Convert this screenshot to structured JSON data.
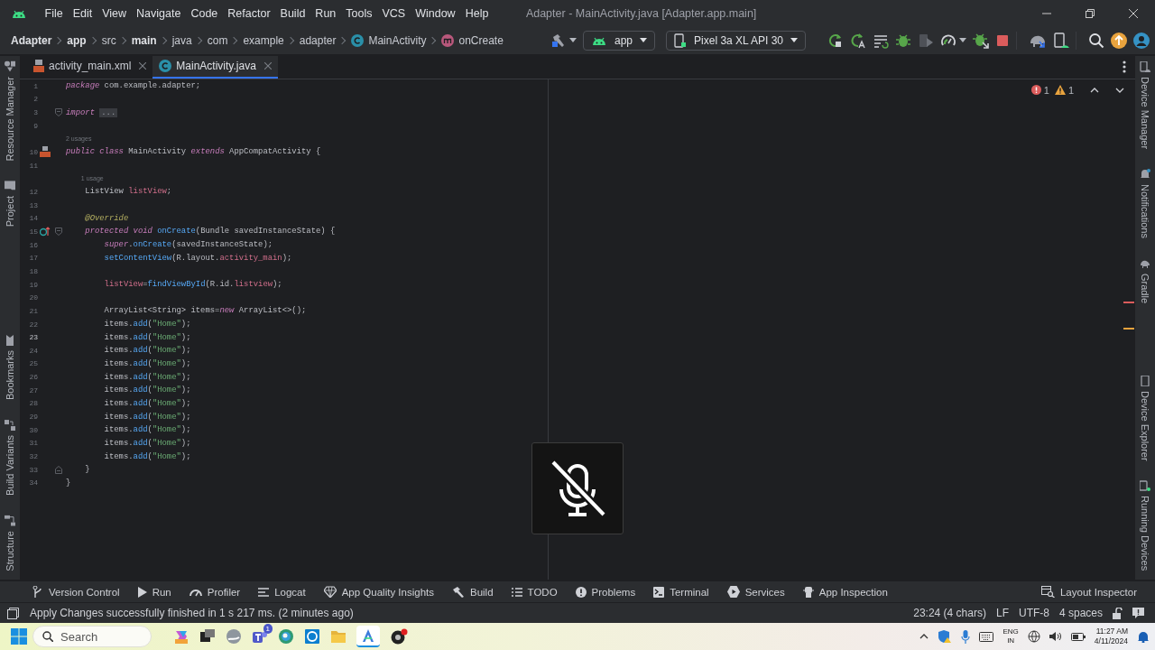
{
  "title_bar": {
    "menu": [
      "File",
      "Edit",
      "View",
      "Navigate",
      "Code",
      "Refactor",
      "Build",
      "Run",
      "Tools",
      "VCS",
      "Window",
      "Help"
    ],
    "title": "Adapter - MainActivity.java [Adapter.app.main]"
  },
  "breadcrumbs": [
    {
      "label": "Adapter",
      "kind": "bold"
    },
    {
      "label": "app",
      "kind": "bold"
    },
    {
      "label": "src",
      "kind": "plain"
    },
    {
      "label": "main",
      "kind": "bold"
    },
    {
      "label": "java",
      "kind": "plain"
    },
    {
      "label": "com",
      "kind": "plain"
    },
    {
      "label": "example",
      "kind": "plain"
    },
    {
      "label": "adapter",
      "kind": "plain"
    },
    {
      "label": "MainActivity",
      "kind": "class"
    },
    {
      "label": "onCreate",
      "kind": "method"
    }
  ],
  "toolbar": {
    "run_config": "app",
    "device": "Pixel 3a XL API 30"
  },
  "tabs": [
    {
      "label": "activity_main.xml",
      "kind": "xml",
      "selected": false
    },
    {
      "label": "MainActivity.java",
      "kind": "class",
      "selected": true
    }
  ],
  "left_panels": {
    "top": [
      "Resource Manager",
      "Project"
    ],
    "bottom": [
      "Bookmarks",
      "Build Variants",
      "Structure"
    ]
  },
  "right_panels": {
    "top": [
      "Device Manager",
      "Notifications",
      "Gradle"
    ],
    "bottom": [
      "Device Explorer",
      "Running Devices"
    ]
  },
  "editor": {
    "errors": "1",
    "warnings": "1",
    "lines": [
      {
        "num": "1",
        "current": false,
        "fold_start": false,
        "fold_end": false,
        "layout_mark": false,
        "override_mark": false,
        "tokens": [
          {
            "kind": "kw",
            "text": "package "
          },
          {
            "kind": "plain",
            "text": "com.example.adapter;"
          }
        ]
      },
      {
        "num": "2",
        "current": false,
        "fold_start": false,
        "fold_end": false,
        "layout_mark": false,
        "override_mark": false
      },
      {
        "num": "3",
        "current": false,
        "fold_start": true,
        "fold_end": false,
        "layout_mark": false,
        "override_mark": false,
        "tokens": [
          {
            "kind": "kw",
            "text": "import "
          },
          {
            "kind": "fold",
            "text": "..."
          }
        ]
      },
      {
        "num": "9",
        "current": false,
        "fold_start": false,
        "fold_end": false,
        "layout_mark": false,
        "override_mark": false
      },
      {
        "num": "10",
        "current": false,
        "hint": "2 usages",
        "fold_start": false,
        "fold_end": false,
        "layout_mark": true,
        "override_mark": false,
        "tokens": [
          {
            "kind": "kw",
            "text": "public class "
          },
          {
            "kind": "plain",
            "text": "MainActivity "
          },
          {
            "kind": "kw",
            "text": "extends "
          },
          {
            "kind": "plain",
            "text": "AppCompatActivity {"
          }
        ]
      },
      {
        "num": "11",
        "current": false,
        "fold_start": false,
        "fold_end": false,
        "layout_mark": false,
        "override_mark": false
      },
      {
        "num": "12",
        "current": false,
        "hint": "1 usage",
        "fold_start": false,
        "fold_end": false,
        "layout_mark": false,
        "override_mark": false,
        "tokens": [
          {
            "kind": "plain",
            "text": "    ListView "
          },
          {
            "kind": "field",
            "text": "listView"
          },
          {
            "kind": "plain",
            "text": ";"
          }
        ]
      },
      {
        "num": "13",
        "current": false,
        "fold_start": false,
        "fold_end": false,
        "layout_mark": false,
        "override_mark": false
      },
      {
        "num": "14",
        "current": false,
        "fold_start": false,
        "fold_end": false,
        "layout_mark": false,
        "override_mark": false,
        "tokens": [
          {
            "kind": "ann",
            "text": "    @Override"
          }
        ]
      },
      {
        "num": "15",
        "current": false,
        "fold_start": true,
        "fold_end": false,
        "layout_mark": false,
        "override_mark": true,
        "tokens": [
          {
            "kind": "kw",
            "text": "    protected void "
          },
          {
            "kind": "method",
            "text": "onCreate"
          },
          {
            "kind": "plain",
            "text": "(Bundle savedInstanceState) {"
          }
        ]
      },
      {
        "num": "16",
        "current": false,
        "fold_start": false,
        "fold_end": false,
        "layout_mark": false,
        "override_mark": false,
        "tokens": [
          {
            "kind": "kw",
            "text": "        super"
          },
          {
            "kind": "plain",
            "text": "."
          },
          {
            "kind": "method",
            "text": "onCreate"
          },
          {
            "kind": "plain",
            "text": "(savedInstanceState);"
          }
        ]
      },
      {
        "num": "17",
        "current": false,
        "fold_start": false,
        "fold_end": false,
        "layout_mark": false,
        "override_mark": false,
        "tokens": [
          {
            "kind": "method",
            "text": "        setContentView"
          },
          {
            "kind": "plain",
            "text": "(R.layout."
          },
          {
            "kind": "field",
            "text": "activity_main"
          },
          {
            "kind": "plain",
            "text": ");"
          }
        ]
      },
      {
        "num": "18",
        "current": false,
        "fold_start": false,
        "fold_end": false,
        "layout_mark": false,
        "override_mark": false
      },
      {
        "num": "19",
        "current": false,
        "fold_start": false,
        "fold_end": false,
        "layout_mark": false,
        "override_mark": false,
        "tokens": [
          {
            "kind": "field",
            "text": "        listView"
          },
          {
            "kind": "plain",
            "text": "="
          },
          {
            "kind": "method",
            "text": "findViewById"
          },
          {
            "kind": "plain",
            "text": "(R.id."
          },
          {
            "kind": "field",
            "text": "listview"
          },
          {
            "kind": "plain",
            "text": ");"
          }
        ]
      },
      {
        "num": "20",
        "current": false,
        "fold_start": false,
        "fold_end": false,
        "layout_mark": false,
        "override_mark": false
      },
      {
        "num": "21",
        "current": false,
        "fold_start": false,
        "fold_end": false,
        "layout_mark": false,
        "override_mark": false,
        "tokens": [
          {
            "kind": "plain",
            "text": "        ArrayList<String> items="
          },
          {
            "kind": "kw",
            "text": "new "
          },
          {
            "kind": "plain",
            "text": "ArrayList<>();"
          }
        ]
      },
      {
        "num": "22",
        "current": false,
        "fold_start": false,
        "fold_end": false,
        "layout_mark": false,
        "override_mark": false,
        "tokens": [
          {
            "kind": "plain",
            "text": "        items."
          },
          {
            "kind": "method",
            "text": "add"
          },
          {
            "kind": "plain",
            "text": "("
          },
          {
            "kind": "str",
            "text": "\"Home\""
          },
          {
            "kind": "plain",
            "text": ");"
          }
        ]
      },
      {
        "num": "23",
        "current": true,
        "fold_start": false,
        "fold_end": false,
        "layout_mark": false,
        "override_mark": false,
        "tokens": [
          {
            "kind": "plain",
            "text": "        items."
          },
          {
            "kind": "method",
            "text": "add"
          },
          {
            "kind": "plain",
            "text": "("
          },
          {
            "kind": "str",
            "text": "\"Home\""
          },
          {
            "kind": "plain",
            "text": ");"
          }
        ]
      },
      {
        "num": "24",
        "current": false,
        "fold_start": false,
        "fold_end": false,
        "layout_mark": false,
        "override_mark": false,
        "tokens": [
          {
            "kind": "plain",
            "text": "        items."
          },
          {
            "kind": "method",
            "text": "add"
          },
          {
            "kind": "plain",
            "text": "("
          },
          {
            "kind": "str",
            "text": "\"Home\""
          },
          {
            "kind": "plain",
            "text": ");"
          }
        ]
      },
      {
        "num": "25",
        "current": false,
        "fold_start": false,
        "fold_end": false,
        "layout_mark": false,
        "override_mark": false,
        "tokens": [
          {
            "kind": "plain",
            "text": "        items."
          },
          {
            "kind": "method",
            "text": "add"
          },
          {
            "kind": "plain",
            "text": "("
          },
          {
            "kind": "str",
            "text": "\"Home\""
          },
          {
            "kind": "plain",
            "text": ");"
          }
        ]
      },
      {
        "num": "26",
        "current": false,
        "fold_start": false,
        "fold_end": false,
        "layout_mark": false,
        "override_mark": false,
        "tokens": [
          {
            "kind": "plain",
            "text": "        items."
          },
          {
            "kind": "method",
            "text": "add"
          },
          {
            "kind": "plain",
            "text": "("
          },
          {
            "kind": "str",
            "text": "\"Home\""
          },
          {
            "kind": "plain",
            "text": ");"
          }
        ]
      },
      {
        "num": "27",
        "current": false,
        "fold_start": false,
        "fold_end": false,
        "layout_mark": false,
        "override_mark": false,
        "tokens": [
          {
            "kind": "plain",
            "text": "        items."
          },
          {
            "kind": "method",
            "text": "add"
          },
          {
            "kind": "plain",
            "text": "("
          },
          {
            "kind": "str",
            "text": "\"Home\""
          },
          {
            "kind": "plain",
            "text": ");"
          }
        ]
      },
      {
        "num": "28",
        "current": false,
        "fold_start": false,
        "fold_end": false,
        "layout_mark": false,
        "override_mark": false,
        "tokens": [
          {
            "kind": "plain",
            "text": "        items."
          },
          {
            "kind": "method",
            "text": "add"
          },
          {
            "kind": "plain",
            "text": "("
          },
          {
            "kind": "str",
            "text": "\"Home\""
          },
          {
            "kind": "plain",
            "text": ");"
          }
        ]
      },
      {
        "num": "29",
        "current": false,
        "fold_start": false,
        "fold_end": false,
        "layout_mark": false,
        "override_mark": false,
        "tokens": [
          {
            "kind": "plain",
            "text": "        items."
          },
          {
            "kind": "method",
            "text": "add"
          },
          {
            "kind": "plain",
            "text": "("
          },
          {
            "kind": "str",
            "text": "\"Home\""
          },
          {
            "kind": "plain",
            "text": ");"
          }
        ]
      },
      {
        "num": "30",
        "current": false,
        "fold_start": false,
        "fold_end": false,
        "layout_mark": false,
        "override_mark": false,
        "tokens": [
          {
            "kind": "plain",
            "text": "        items."
          },
          {
            "kind": "method",
            "text": "add"
          },
          {
            "kind": "plain",
            "text": "("
          },
          {
            "kind": "str",
            "text": "\"Home\""
          },
          {
            "kind": "plain",
            "text": ");"
          }
        ]
      },
      {
        "num": "31",
        "current": false,
        "fold_start": false,
        "fold_end": false,
        "layout_mark": false,
        "override_mark": false,
        "tokens": [
          {
            "kind": "plain",
            "text": "        items."
          },
          {
            "kind": "method",
            "text": "add"
          },
          {
            "kind": "plain",
            "text": "("
          },
          {
            "kind": "str",
            "text": "\"Home\""
          },
          {
            "kind": "plain",
            "text": ");"
          }
        ]
      },
      {
        "num": "32",
        "current": false,
        "fold_start": false,
        "fold_end": false,
        "layout_mark": false,
        "override_mark": false,
        "tokens": [
          {
            "kind": "plain",
            "text": "        items."
          },
          {
            "kind": "method",
            "text": "add"
          },
          {
            "kind": "plain",
            "text": "("
          },
          {
            "kind": "str",
            "text": "\"Home\""
          },
          {
            "kind": "plain",
            "text": ");"
          }
        ]
      },
      {
        "num": "33",
        "current": false,
        "fold_start": false,
        "fold_end": true,
        "layout_mark": false,
        "override_mark": false,
        "tokens": [
          {
            "kind": "plain",
            "text": "    }"
          }
        ]
      },
      {
        "num": "34",
        "current": false,
        "fold_start": false,
        "fold_end": false,
        "layout_mark": false,
        "override_mark": false,
        "tokens": [
          {
            "kind": "plain",
            "text": "}"
          }
        ]
      }
    ]
  },
  "tool_windows": {
    "left": [
      "Version Control",
      "Run",
      "Profiler",
      "Logcat",
      "App Quality Insights",
      "Build",
      "TODO",
      "Problems",
      "Terminal",
      "Services",
      "App Inspection"
    ],
    "right": [
      "Layout Inspector"
    ]
  },
  "status_bar": {
    "message": "Apply Changes successfully finished in 1 s 217 ms. (2 minutes ago)",
    "position": "23:24 (4 chars)",
    "line_separator": "LF",
    "encoding": "UTF-8",
    "indent": "4 spaces"
  },
  "taskbar": {
    "search_placeholder": "Search",
    "chat_badge": "1",
    "language": "ENG",
    "region": "IN",
    "time": "11:27 AM",
    "date": "4/11/2024"
  }
}
